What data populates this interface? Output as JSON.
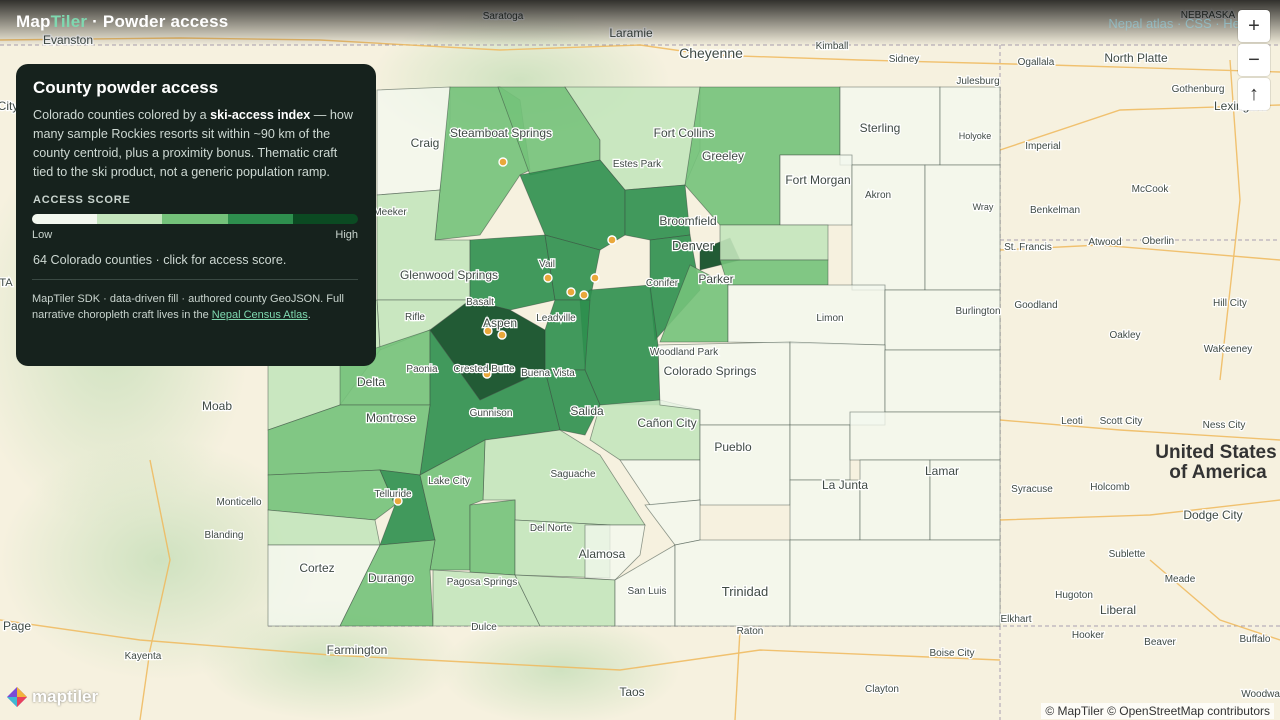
{
  "brand": {
    "part1": "Map",
    "part2": "Tiler",
    "title": "· Powder access"
  },
  "top_links": "Nepal atlas · CSS · Help",
  "controls": {
    "zoom_in": "+",
    "zoom_out": "−",
    "compass": "↑"
  },
  "panel": {
    "title": "County powder access",
    "desc_pre": "Colorado counties colored by a ",
    "desc_bold": "ski-access index",
    "desc_post": " — how many sample Rockies resorts sit within ~90 km of the county centroid, plus a proximity bonus. Thematic craft tied to the ski product, not a generic population ramp.",
    "legend_title": "ACCESS SCORE",
    "low": "Low",
    "high": "High",
    "count": "64 Colorado counties · click for access score.",
    "credit_pre": "MapTiler SDK · data-driven fill · authored county GeoJSON. Full narrative choropleth craft lives in the ",
    "credit_link": "Nepal Census Atlas",
    "credit_post": "."
  },
  "ramp_colors": [
    "#f3f8ef",
    "#c4e5bd",
    "#74c27a",
    "#2e8f4e",
    "#0b4a22"
  ],
  "logo_text": "maptiler",
  "attribution": "© MapTiler © OpenStreetMap contributors",
  "map": {
    "places": [
      {
        "name": "Evanston"
      },
      {
        "name": "Saratoga"
      },
      {
        "name": "Laramie"
      },
      {
        "name": "Cheyenne"
      },
      {
        "name": "Kimball"
      },
      {
        "name": "Sidney"
      },
      {
        "name": "Julesburg"
      },
      {
        "name": "Ogallala"
      },
      {
        "name": "North Platte"
      },
      {
        "name": "NEBRASKA"
      },
      {
        "name": "Gothenburg"
      },
      {
        "name": "Lexington"
      },
      {
        "name": "Steamboat Springs"
      },
      {
        "name": "Fort Collins"
      },
      {
        "name": "Greeley"
      },
      {
        "name": "Sterling"
      },
      {
        "name": "Holyoke"
      },
      {
        "name": "Estes Park"
      },
      {
        "name": "Craig"
      },
      {
        "name": "Fort Morgan"
      },
      {
        "name": "Imperial"
      },
      {
        "name": "Akron"
      },
      {
        "name": "McCook"
      },
      {
        "name": "Meeker"
      },
      {
        "name": "Broomfield"
      },
      {
        "name": "Denver"
      },
      {
        "name": "Wray"
      },
      {
        "name": "Benkelman"
      },
      {
        "name": "St. Francis"
      },
      {
        "name": "Atwood"
      },
      {
        "name": "Oberlin"
      },
      {
        "name": "Glenwood Springs"
      },
      {
        "name": "Vail"
      },
      {
        "name": "Conifer"
      },
      {
        "name": "Parker"
      },
      {
        "name": "Rifle"
      },
      {
        "name": "Basalt"
      },
      {
        "name": "Leadville"
      },
      {
        "name": "Limon"
      },
      {
        "name": "Burlington"
      },
      {
        "name": "Goodland"
      },
      {
        "name": "Hill City"
      },
      {
        "name": "Oakley"
      },
      {
        "name": "Aspen"
      },
      {
        "name": "Delta"
      },
      {
        "name": "Paonia"
      },
      {
        "name": "Crested Butte"
      },
      {
        "name": "Buena Vista"
      },
      {
        "name": "Woodland Park"
      },
      {
        "name": "Colorado Springs"
      },
      {
        "name": "WaKeeney"
      },
      {
        "name": "Moab"
      },
      {
        "name": "Montrose"
      },
      {
        "name": "Gunnison"
      },
      {
        "name": "Salida"
      },
      {
        "name": "Cañon City"
      },
      {
        "name": "Pueblo"
      },
      {
        "name": "Leoti"
      },
      {
        "name": "Scott City"
      },
      {
        "name": "Ness City"
      },
      {
        "name": "Saguache"
      },
      {
        "name": "Lamar"
      },
      {
        "name": "Monticello"
      },
      {
        "name": "Telluride"
      },
      {
        "name": "Lake City"
      },
      {
        "name": "La Junta"
      },
      {
        "name": "Syracuse"
      },
      {
        "name": "Holcomb"
      },
      {
        "name": "Dodge City"
      },
      {
        "name": "Blanding"
      },
      {
        "name": "Del Norte"
      },
      {
        "name": "Alamosa"
      },
      {
        "name": "Sublette"
      },
      {
        "name": "Meade"
      },
      {
        "name": "Cortez"
      },
      {
        "name": "Durango"
      },
      {
        "name": "Pagosa Springs"
      },
      {
        "name": "San Luis"
      },
      {
        "name": "Trinidad"
      },
      {
        "name": "Hugoton"
      },
      {
        "name": "Liberal"
      },
      {
        "name": "Page"
      },
      {
        "name": "Dulce"
      },
      {
        "name": "Raton"
      },
      {
        "name": "Elkhart"
      },
      {
        "name": "Hooker"
      },
      {
        "name": "Beaver"
      },
      {
        "name": "Buffalo"
      },
      {
        "name": "Kayenta"
      },
      {
        "name": "Farmington"
      },
      {
        "name": "Boise City"
      },
      {
        "name": "Taos"
      },
      {
        "name": "Clayton"
      },
      {
        "name": "Woodward"
      },
      {
        "name": "City"
      },
      {
        "name": "TA"
      }
    ],
    "country_label_1": "United States",
    "country_label_2": "of America",
    "resorts": [
      {
        "name": "Steamboat Springs"
      },
      {
        "name": "Winter Park"
      },
      {
        "name": "Vail"
      },
      {
        "name": "Beaver Creek"
      },
      {
        "name": "Copper Mountain"
      },
      {
        "name": "Breckenridge"
      },
      {
        "name": "Keystone"
      },
      {
        "name": "Snowmass"
      },
      {
        "name": "Aspen"
      },
      {
        "name": "Crested Butte"
      },
      {
        "name": "Telluride"
      }
    ]
  }
}
